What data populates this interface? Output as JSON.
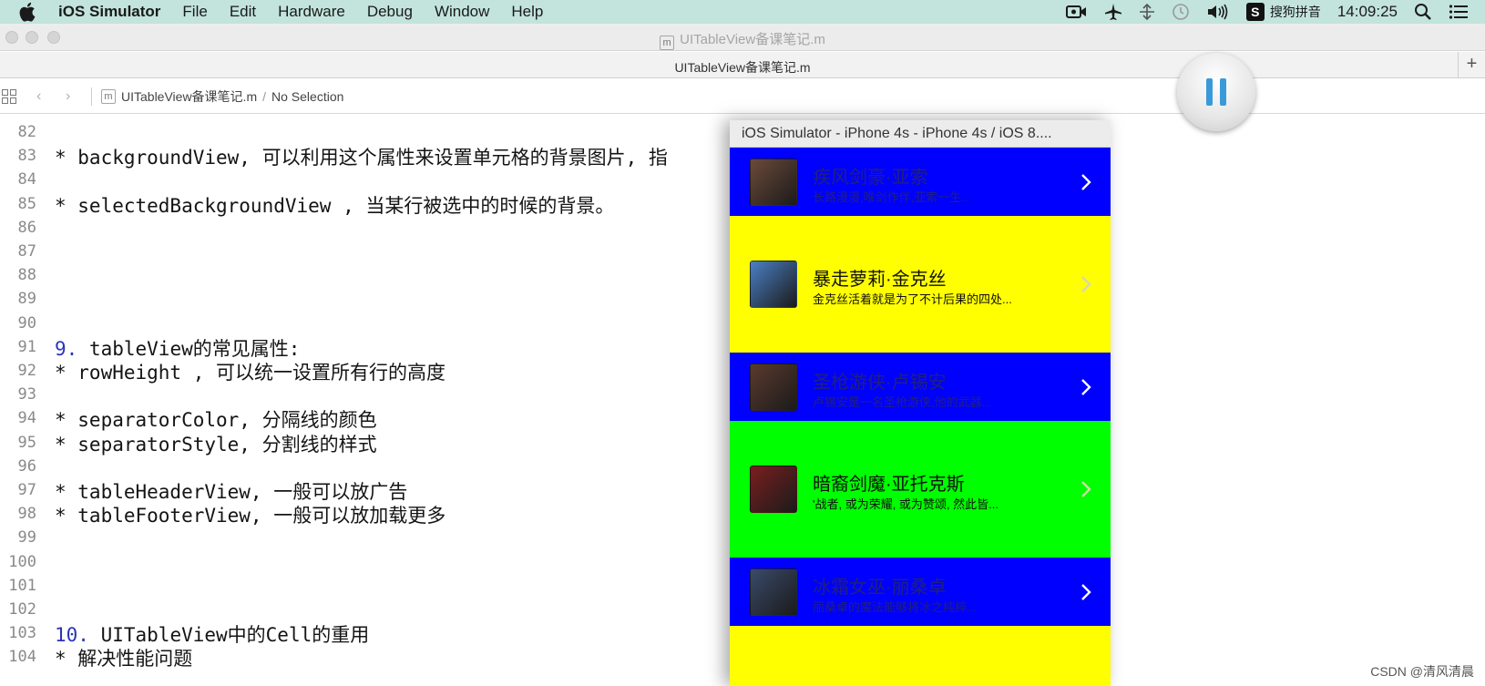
{
  "menubar": {
    "apple_icon": "apple-logo",
    "app_name": "iOS Simulator",
    "items": [
      "File",
      "Edit",
      "Hardware",
      "Debug",
      "Window",
      "Help"
    ],
    "ime_label": "搜狗拼音",
    "clock": "14:09:25"
  },
  "window": {
    "title": "UITableView备课笔记.m",
    "tab_label": "UITableView备课笔记.m",
    "add_tab": "+"
  },
  "jumpbar": {
    "file_glyph": "m",
    "file": "UITableView备课笔记.m",
    "separator": "/",
    "selection": "No Selection"
  },
  "editor": {
    "lines": [
      {
        "no": "82",
        "num": "",
        "text": ""
      },
      {
        "no": "83",
        "num": "",
        "text": "* backgroundView, 可以利用这个属性来设置单元格的背景图片, 指"
      },
      {
        "no": "84",
        "num": "",
        "text": ""
      },
      {
        "no": "85",
        "num": "",
        "text": "* selectedBackgroundView , 当某行被选中的时候的背景。"
      },
      {
        "no": "86",
        "num": "",
        "text": ""
      },
      {
        "no": "87",
        "num": "",
        "text": ""
      },
      {
        "no": "88",
        "num": "",
        "text": ""
      },
      {
        "no": "89",
        "num": "",
        "text": ""
      },
      {
        "no": "90",
        "num": "",
        "text": ""
      },
      {
        "no": "91",
        "num": "9.",
        "text": " tableView的常见属性:"
      },
      {
        "no": "92",
        "num": "",
        "text": "* rowHeight , 可以统一设置所有行的高度"
      },
      {
        "no": "93",
        "num": "",
        "text": ""
      },
      {
        "no": "94",
        "num": "",
        "text": "* separatorColor, 分隔线的颜色"
      },
      {
        "no": "95",
        "num": "",
        "text": "* separatorStyle, 分割线的样式"
      },
      {
        "no": "96",
        "num": "",
        "text": ""
      },
      {
        "no": "97",
        "num": "",
        "text": "* tableHeaderView, 一般可以放广告"
      },
      {
        "no": "98",
        "num": "",
        "text": "* tableFooterView, 一般可以放加载更多"
      },
      {
        "no": "99",
        "num": "",
        "text": ""
      },
      {
        "no": "100",
        "num": "",
        "text": ""
      },
      {
        "no": "101",
        "num": "",
        "text": ""
      },
      {
        "no": "102",
        "num": "",
        "text": ""
      },
      {
        "no": "103",
        "num": "10.",
        "text": " UITableView中的Cell的重用"
      },
      {
        "no": "104",
        "num": "",
        "text": "* 解决性能问题"
      }
    ]
  },
  "simulator": {
    "title": "iOS Simulator - iPhone 4s - iPhone 4s / iOS 8....",
    "cells": [
      {
        "name": "疾风剑豪·亚索",
        "intro": "长路漫漫,唯剑作伴,亚索一生..",
        "bg": "#0000ff",
        "dim": true,
        "avatar": "#6b4a3a"
      },
      {
        "name": "暴走萝莉·金克丝",
        "intro": "金克丝活着就是为了不计后果的四处...",
        "bg": "#ffff00",
        "dim": false,
        "avatar": "#4a7fc4"
      },
      {
        "name": "圣枪游侠·卢锡安",
        "intro": "卢锡安是一名圣枪游侠,他的武器...",
        "bg": "#0000ff",
        "dim": true,
        "avatar": "#5a3a2e"
      },
      {
        "name": "暗裔剑魔·亚托克斯",
        "intro": "'战者, 或为荣耀, 或为赞颂, 然此皆...",
        "bg": "#00ff00",
        "dim": false,
        "avatar": "#7a1e1e"
      },
      {
        "name": "冰霜女巫·丽桑卓",
        "intro": "丽桑卓的魔法能够将冰之纯粹...",
        "bg": "#0000ff",
        "dim": true,
        "avatar": "#3a4a6a"
      },
      {
        "name": "",
        "intro": "",
        "bg": "#ffff00",
        "dim": false,
        "avatar": ""
      }
    ]
  },
  "watermark": "CSDN @清风清晨"
}
